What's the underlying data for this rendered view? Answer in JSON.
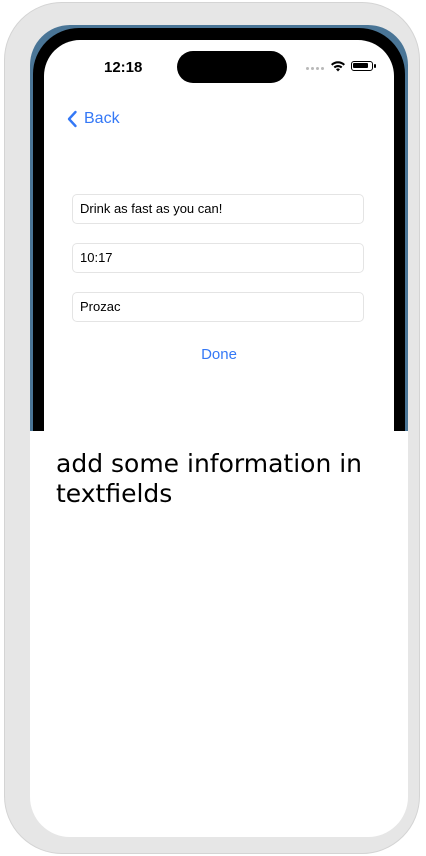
{
  "status_bar": {
    "time": "12:18"
  },
  "navigation": {
    "back_label": "Back"
  },
  "form": {
    "fields": [
      {
        "value": "Drink as fast as you can!"
      },
      {
        "value": "10:17"
      },
      {
        "value": "Prozac"
      }
    ],
    "done_label": "Done"
  },
  "caption": {
    "text": "add some information in textfields"
  },
  "colors": {
    "accent": "#3478f6",
    "wallpaper": "#4a7596",
    "frame": "#e6e6e6"
  },
  "icons": {
    "back": "chevron-left-icon",
    "signal": "signal-dots-icon",
    "wifi": "wifi-icon",
    "battery": "battery-icon"
  }
}
